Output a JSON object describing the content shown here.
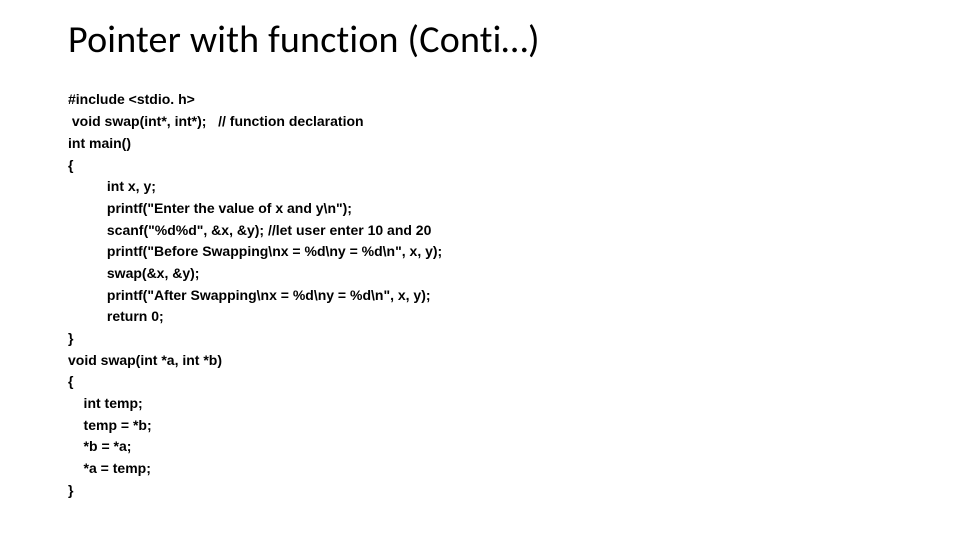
{
  "title": "Pointer with function (Conti…)",
  "code": {
    "l01": "#include <stdio. h>",
    "l02": " void swap(int*, int*);   // function declaration",
    "l03": "int main()",
    "l04": "{",
    "l05": "          int x, y;",
    "l06": "          printf(\"Enter the value of x and y\\n\");",
    "l07": "          scanf(\"%d%d\", &x, &y); //let user enter 10 and 20",
    "l08": "          printf(\"Before Swapping\\nx = %d\\ny = %d\\n\", x, y);",
    "l09": "          swap(&x, &y);",
    "l10": "          printf(\"After Swapping\\nx = %d\\ny = %d\\n\", x, y);",
    "l11": "          return 0;",
    "l12": "}",
    "l13": "void swap(int *a, int *b)",
    "l14": "{",
    "l15": "    int temp;",
    "l16": "    temp = *b;",
    "l17": "    *b = *a;",
    "l18": "    *a = temp;",
    "l19": "}"
  }
}
